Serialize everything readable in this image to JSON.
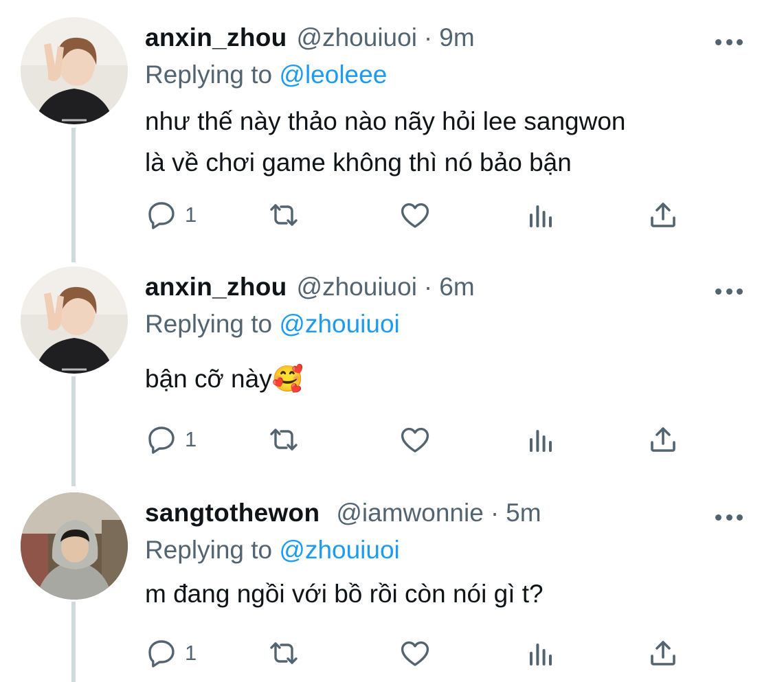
{
  "colors": {
    "text": "#0f1419",
    "secondary": "#536471",
    "accent": "#1d9bf0",
    "thread_line": "#cfd9de"
  },
  "tweets": [
    {
      "name": "anxin_zhou",
      "handle": "@zhouiuoi",
      "separator": "·",
      "time": "9m",
      "replying_prefix": "Replying to",
      "replying_to": "@leoleee",
      "text_lines": [
        "như thế này thảo nào nãy hỏi lee sangwon",
        "là về chơi game không thì nó bảo bận"
      ],
      "reply_count": "1",
      "avatar": "avatar-anxin"
    },
    {
      "name": "anxin_zhou",
      "handle": "@zhouiuoi",
      "separator": "·",
      "time": "6m",
      "replying_prefix": "Replying to",
      "replying_to": "@zhouiuoi",
      "text_lines": [
        "bận cỡ này🥰"
      ],
      "reply_count": "1",
      "avatar": "avatar-anxin"
    },
    {
      "name": "sangtothewon",
      "handle": "@iamwonnie",
      "separator": "·",
      "time": "5m",
      "replying_prefix": "Replying to",
      "replying_to": "@zhouiuoi",
      "text_lines": [
        "m đang ngồi với bồ rồi còn nói gì t?"
      ],
      "reply_count": "1",
      "avatar": "avatar-sangwon"
    }
  ],
  "icons": [
    "reply-icon",
    "retweet-icon",
    "like-icon",
    "analytics-icon",
    "share-icon",
    "more-icon"
  ]
}
